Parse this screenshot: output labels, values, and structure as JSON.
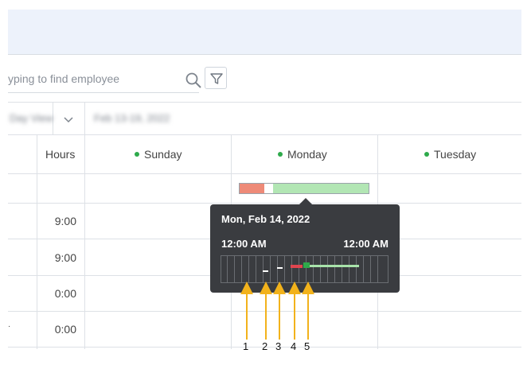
{
  "search": {
    "placeholder": "yping to find employee"
  },
  "toolbar": {
    "filter_icon": "filter-icon",
    "search_icon": "search-icon"
  },
  "filters": {
    "view_select": "Day View",
    "date_range": "Feb 13-19, 2022",
    "chevron_icon": "chevron-down-icon"
  },
  "grid": {
    "hours_header": "Hours",
    "days": [
      {
        "label": "Sunday",
        "dot_color": "#2eaa4b"
      },
      {
        "label": "Monday",
        "dot_color": "#2eaa4b"
      },
      {
        "label": "Tuesday",
        "dot_color": "#2eaa4b"
      }
    ],
    "rows": [
      {
        "hours": ""
      },
      {
        "hours": "9:00"
      },
      {
        "hours": "9:00"
      },
      {
        "hours": "0:00"
      },
      {
        "hours": "0:00"
      }
    ],
    "stray_mark": "·"
  },
  "activity_bar": {
    "segments": [
      {
        "color": "#ee8a78",
        "fraction": 0.19
      },
      {
        "color": "#ffffff",
        "fraction": 0.07
      },
      {
        "color": "#b2e6b4",
        "fraction": 0.74
      }
    ]
  },
  "tooltip": {
    "date": "Mon, Feb 14, 2022",
    "start_time": "12:00 AM",
    "end_time": "12:00 AM",
    "colors": {
      "background": "#3a3c40",
      "grid": "#6a6d72",
      "idle": "#ffffff",
      "alert": "#e0454f",
      "active": "#2fa84a",
      "light_active": "#a8e3aa"
    }
  },
  "annotations": {
    "labels": [
      "1",
      "2",
      "3",
      "4",
      "5"
    ],
    "color": "#f2b21b"
  }
}
